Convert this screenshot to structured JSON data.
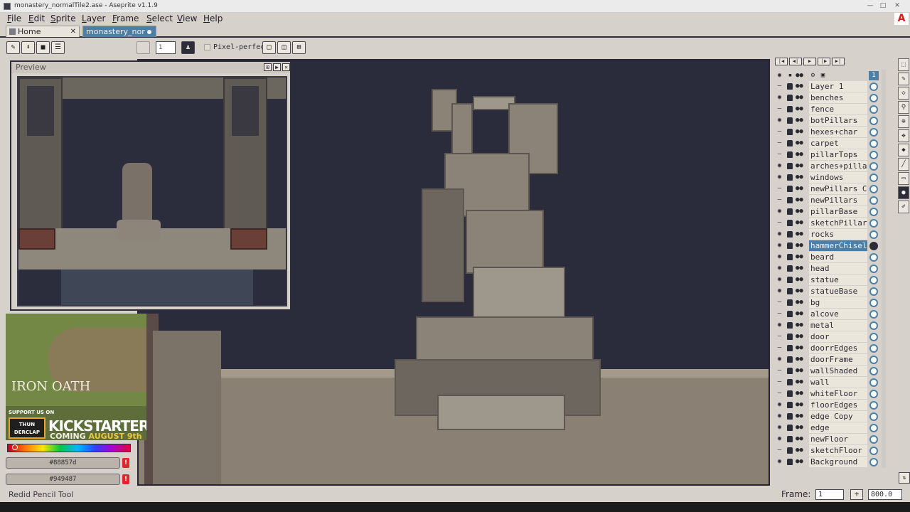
{
  "window": {
    "title": "monastery_normalTile2.ase - Aseprite v1.1.9",
    "minimize": "—",
    "maximize": "□",
    "close": "✕"
  },
  "menu": [
    "File",
    "Edit",
    "Sprite",
    "Layer",
    "Frame",
    "Select",
    "View",
    "Help"
  ],
  "tabs": [
    {
      "label": "Home",
      "close": "✕"
    },
    {
      "label": "monastery_nor",
      "modified": true
    }
  ],
  "toolbar": {
    "pixel_perfect_label": "Pixel-perfect",
    "brush_size": "1"
  },
  "preview": {
    "title": "Preview",
    "buttons": [
      "⊞",
      "▶",
      "✕"
    ]
  },
  "ad": {
    "game_title": "IRON OATH",
    "support": "SUPPORT US ON",
    "thunder": "THUN DERCLAP",
    "kickstarter": "KICKSTARTER",
    "coming": "COMING",
    "date": "AUGUST 9th"
  },
  "colors": {
    "foreground": "#88857d",
    "background": "#949487",
    "accent": "#4d7ea5"
  },
  "status": {
    "message": "Redid Pencil Tool",
    "frame_label": "Frame:",
    "frame_value": "1",
    "zoom": "800.0"
  },
  "timeline": {
    "frame_number": "1",
    "layers": [
      {
        "name": "Layer 1",
        "visible": false
      },
      {
        "name": "benches",
        "visible": true
      },
      {
        "name": "fence",
        "visible": false
      },
      {
        "name": "botPillars",
        "visible": true
      },
      {
        "name": "hexes+char",
        "visible": false
      },
      {
        "name": "carpet",
        "visible": false
      },
      {
        "name": "pillarTops",
        "visible": false
      },
      {
        "name": "arches+pillar",
        "visible": true
      },
      {
        "name": "windows",
        "visible": true
      },
      {
        "name": "newPillars Copy",
        "visible": false
      },
      {
        "name": "newPillars",
        "visible": false
      },
      {
        "name": "pillarBase",
        "visible": true
      },
      {
        "name": "sketchPillars",
        "visible": false
      },
      {
        "name": "rocks",
        "visible": true
      },
      {
        "name": "hammerChisel",
        "visible": true,
        "selected": true
      },
      {
        "name": "beard",
        "visible": true
      },
      {
        "name": "head",
        "visible": true
      },
      {
        "name": "statue",
        "visible": true
      },
      {
        "name": "statueBase",
        "visible": true
      },
      {
        "name": "bg",
        "visible": false
      },
      {
        "name": "alcove",
        "visible": false
      },
      {
        "name": "metal",
        "visible": true
      },
      {
        "name": "door",
        "visible": false
      },
      {
        "name": "doorrEdges",
        "visible": false
      },
      {
        "name": "doorFrame",
        "visible": true
      },
      {
        "name": "wallShaded",
        "visible": false
      },
      {
        "name": "wall",
        "visible": false
      },
      {
        "name": "whiteFloor",
        "visible": false
      },
      {
        "name": "floorEdges",
        "visible": true
      },
      {
        "name": "edge Copy",
        "visible": true
      },
      {
        "name": "edge",
        "visible": true
      },
      {
        "name": "newFloor",
        "visible": true
      },
      {
        "name": "sketchFloor",
        "visible": false
      },
      {
        "name": "Background",
        "visible": true
      }
    ]
  },
  "tools": [
    "marquee",
    "pencil",
    "eraser",
    "eyedropper",
    "zoom",
    "move",
    "fill",
    "line",
    "rectangle",
    "blur",
    "ink"
  ]
}
